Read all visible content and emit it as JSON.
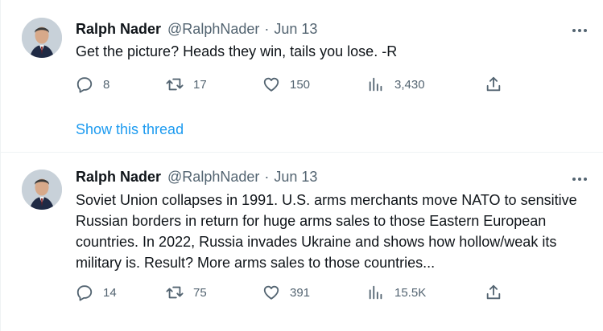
{
  "tweets": [
    {
      "author": {
        "name": "Ralph Nader",
        "handle": "@RalphNader"
      },
      "separator": "·",
      "date": "Jun 13",
      "text": "Get the picture? Heads they win, tails you lose. -R",
      "stats": {
        "replies": "8",
        "retweets": "17",
        "likes": "150",
        "views": "3,430"
      },
      "show_thread": "Show this thread"
    },
    {
      "author": {
        "name": "Ralph Nader",
        "handle": "@RalphNader"
      },
      "separator": "·",
      "date": "Jun 13",
      "text": "Soviet Union collapses in 1991. U.S. arms merchants move NATO to sensitive Russian borders in return for huge arms sales to those Eastern European countries. In 2022, Russia invades Ukraine and shows how hollow/weak its military is. Result? More arms sales to those countries...",
      "stats": {
        "replies": "14",
        "retweets": "75",
        "likes": "391",
        "views": "15.5K"
      }
    }
  ],
  "icons": {
    "more": "more-horizontal-icon",
    "reply": "reply-icon",
    "retweet": "retweet-icon",
    "like": "heart-icon",
    "views": "views-bar-chart-icon",
    "share": "share-icon"
  },
  "colors": {
    "text_primary": "#0f1419",
    "text_secondary": "#536471",
    "link": "#1d9bf0",
    "divider": "#eff3f4"
  }
}
